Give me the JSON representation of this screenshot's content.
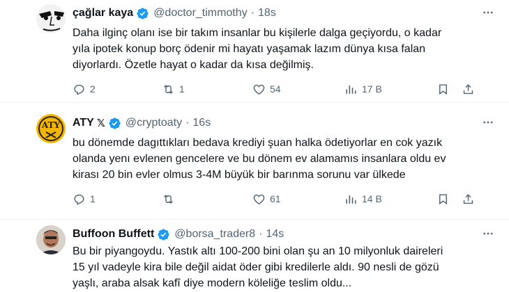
{
  "tweets": [
    {
      "name": "çağlar kaya",
      "handle": "@doctor_timmothy",
      "separator": "·",
      "time": "18s",
      "text_lines": [
        "Daha ilginç olanı ise bir takım insanlar bu kişilerle dalga geçiyordu, o kadar",
        "yıla ipotek konup borç ödenir mi hayatı yaşamak lazım dünya kısa falan",
        "diyorlardı. Özetle hayat o kadar da kısa değilmiş."
      ],
      "replies": "2",
      "reposts": "1",
      "likes": "54",
      "views": "17 B"
    },
    {
      "name": "ATY",
      "badge": "𝕏",
      "handle": "@cryptoaty",
      "separator": "·",
      "time": "16s",
      "text_lines": [
        "bu dönemde dagıttıkları bedava krediyi şuan halka ödetiyorlar en cok yazık",
        "olanda yenı evlenen gencelere ve bu dönem ev alamamıs insanlara oldu ev",
        "kirası 20 bin evler olmus 3-4M büyük bir barınma sorunu var ülkede"
      ],
      "replies": "1",
      "reposts": "",
      "likes": "61",
      "views": "14 B"
    },
    {
      "name": "Buffoon Buffett",
      "handle": "@borsa_trader8",
      "separator": "·",
      "time": "14s",
      "text_lines": [
        "Bu bir piyangoydu. Yastık altı 100-200 bini olan şu an 10 milyonluk daireleri",
        "15 yıl vadeyle kira bile değil aidat öder gibi kredilerle aldı. 90 nesli de gözü",
        "yaşlı, araba alsak kafî diye modern köleliğe teslim oldu..."
      ]
    }
  ],
  "colors": {
    "verified": "#1d9bf0",
    "muted": "#536471",
    "text": "#0f1419",
    "divider": "#eff3f4"
  },
  "icons": [
    "reply-icon",
    "repost-icon",
    "like-icon",
    "views-icon",
    "bookmark-icon",
    "share-icon",
    "more-icon",
    "verified-icon"
  ]
}
